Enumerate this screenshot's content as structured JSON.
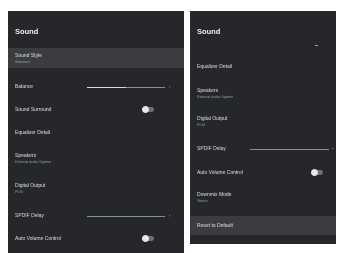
{
  "left": {
    "title": "Sound",
    "items": [
      {
        "label": "Sound Style",
        "sub": "Standard"
      },
      {
        "label": "Balance"
      },
      {
        "label": "Sound Surround"
      },
      {
        "label": "Equalizer Detail"
      },
      {
        "label": "Speakers",
        "sub": "External Audio System"
      },
      {
        "label": "Digital Output",
        "sub": "PCM"
      },
      {
        "label": "SPDIF Delay"
      },
      {
        "label": "Auto Volume Control"
      }
    ]
  },
  "right": {
    "title": "Sound",
    "items": [
      {
        "label": "Equalizer Detail"
      },
      {
        "label": "Speakers",
        "sub": "External Audio System"
      },
      {
        "label": "Digital Output",
        "sub": "PCM"
      },
      {
        "label": "SPDIF Delay"
      },
      {
        "label": "Auto Volume Control"
      },
      {
        "label": "Downmix Mode",
        "sub": "Stereo"
      },
      {
        "label": "Reset to Default"
      }
    ]
  },
  "controls": {
    "balance_level": 0.5,
    "spdif_delay_level_left": 0.0,
    "spdif_delay_level_right": 0.0,
    "sound_surround_on": false,
    "auto_volume_on": false,
    "arrow_glyph": "›"
  },
  "colors": {
    "panel_bg": "#25272a",
    "selected_bg": "#3a3c40",
    "text": "#e2e2e2",
    "subtext": "#9aa0a6"
  }
}
